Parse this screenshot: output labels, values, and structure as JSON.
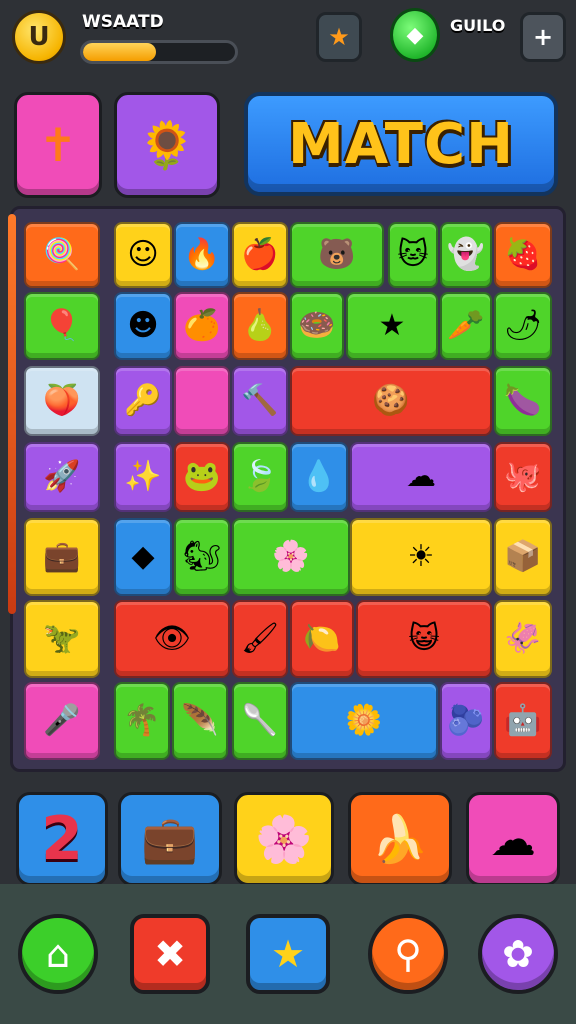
{
  "hud": {
    "title": "WSAATD",
    "coin_glyph": "U",
    "progress": 0.48,
    "star_button_icon": "star-icon",
    "gem_icon": "green-gem-icon",
    "gem_label": "GUILO",
    "plus_label": "+"
  },
  "colors": {
    "orange": "#ff6a1a",
    "green": "#4fd42a",
    "yellow": "#ffd21a",
    "blue": "#2f8fe8",
    "pink": "#f04cb8",
    "purple": "#a257e8",
    "red": "#ef3b2a",
    "cream": "#cfe3f2"
  },
  "top": {
    "tile1_icon": "orange-figure-icon",
    "tile2_icon": "flower-bird-icon",
    "banner_text": "MATCH"
  },
  "board": {
    "tiles": [
      {
        "icon": "lollipop",
        "glyph": "🍭"
      },
      {
        "icon": "face",
        "glyph": "☺"
      },
      {
        "icon": "flame",
        "glyph": "🔥"
      },
      {
        "icon": "apple",
        "glyph": "🍎"
      },
      {
        "icon": "bear",
        "glyph": "🐻"
      },
      {
        "icon": "cat",
        "glyph": "🐱"
      },
      {
        "icon": "ghost",
        "glyph": "👻"
      },
      {
        "icon": "berry",
        "glyph": "🍓"
      },
      {
        "icon": "balloon",
        "glyph": "🎈"
      },
      {
        "icon": "blue-face",
        "glyph": "☻"
      },
      {
        "icon": "orange",
        "glyph": "🍊"
      },
      {
        "icon": "pear",
        "glyph": "🍐"
      },
      {
        "icon": "donut",
        "glyph": "🍩"
      },
      {
        "icon": "star-face",
        "glyph": "★"
      },
      {
        "icon": "carrot",
        "glyph": "🥕"
      },
      {
        "icon": "bell-pepper",
        "glyph": "🌶"
      },
      {
        "icon": "peach",
        "glyph": "🍑"
      },
      {
        "icon": "key",
        "glyph": "🔑"
      },
      {
        "icon": "blank",
        "glyph": ""
      },
      {
        "icon": "hammer",
        "glyph": "🔨"
      },
      {
        "icon": "cracker",
        "glyph": "🍪"
      },
      {
        "icon": "eggplant",
        "glyph": "🍆"
      },
      {
        "icon": "rocket",
        "glyph": "🚀"
      },
      {
        "icon": "wand",
        "glyph": "✨"
      },
      {
        "icon": "frog",
        "glyph": "🐸"
      },
      {
        "icon": "leaf",
        "glyph": "🍃"
      },
      {
        "icon": "splat",
        "glyph": "💧"
      },
      {
        "icon": "cloud",
        "glyph": "☁"
      },
      {
        "icon": "octopus",
        "glyph": "🐙"
      },
      {
        "icon": "suitcase",
        "glyph": "💼"
      },
      {
        "icon": "diamond",
        "glyph": "◆"
      },
      {
        "icon": "squirrel",
        "glyph": "🐿"
      },
      {
        "icon": "flower",
        "glyph": "🌸"
      },
      {
        "icon": "sun",
        "glyph": "☀"
      },
      {
        "icon": "box",
        "glyph": "📦"
      },
      {
        "icon": "dino",
        "glyph": "🦖"
      },
      {
        "icon": "eye",
        "glyph": "👁"
      },
      {
        "icon": "brush",
        "glyph": "🖌"
      },
      {
        "icon": "lemon",
        "glyph": "🍋"
      },
      {
        "icon": "cat-face",
        "glyph": "😺"
      },
      {
        "icon": "squid",
        "glyph": "🦑"
      },
      {
        "icon": "mic",
        "glyph": "🎤"
      },
      {
        "icon": "palm",
        "glyph": "🌴"
      },
      {
        "icon": "feather",
        "glyph": "🪶"
      },
      {
        "icon": "spoon",
        "glyph": "🥄"
      },
      {
        "icon": "blossom",
        "glyph": "🌼"
      },
      {
        "icon": "beet",
        "glyph": "🫐"
      },
      {
        "icon": "robot",
        "glyph": "🤖"
      }
    ]
  },
  "tray": {
    "number": "2",
    "item2_icon": "briefcase-icon",
    "item3_icon": "gem-flower-icon",
    "item4_icon": "banana-icon",
    "item5_icon": "cloud-icon"
  },
  "controls": {
    "home_icon": "home-arrow-icon",
    "close_icon": "cross-icon",
    "star_icon": "star-icon",
    "magnify_icon": "magnifier-icon",
    "settings_icon": "paw-icon"
  }
}
